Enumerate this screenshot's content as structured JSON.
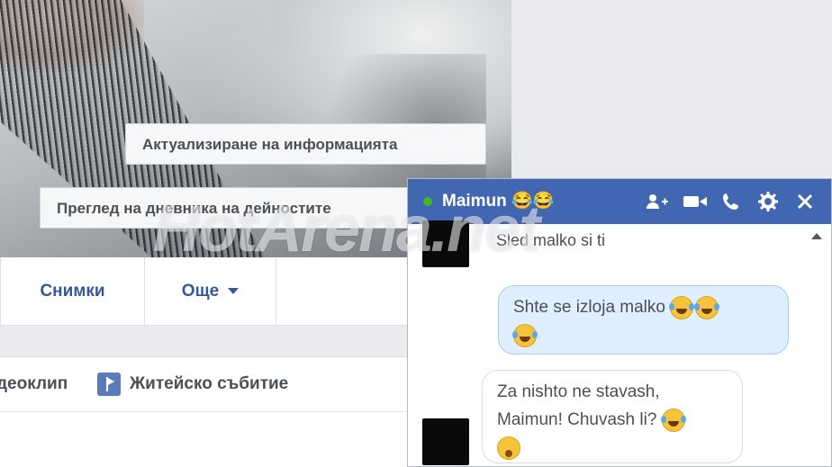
{
  "cover": {
    "update_info_button": "Актуализиране на информацията",
    "activity_log_button": "Преглед на дневника на дейностите"
  },
  "tabs": {
    "photos": "Снимки",
    "more": "Още"
  },
  "composer": {
    "video_partial": "деоклип",
    "life_event": "Житейско събитие"
  },
  "watermark": "HotArena.net",
  "chat": {
    "name": "Maimun",
    "name_emojis": "😂😂",
    "status_color": "#42b72a",
    "header_color": "#4267b2",
    "icons": [
      "add-people-icon",
      "video-camera-icon",
      "phone-icon",
      "gear-icon",
      "close-icon"
    ],
    "messages": [
      {
        "direction": "in",
        "text": "Sled malko si ti"
      },
      {
        "direction": "out",
        "text": "Shte se izloja malko"
      },
      {
        "direction": "in",
        "text_line1": "Za nishto ne stavash,",
        "text_line2": "Maimun! Chuvash li?"
      }
    ]
  }
}
